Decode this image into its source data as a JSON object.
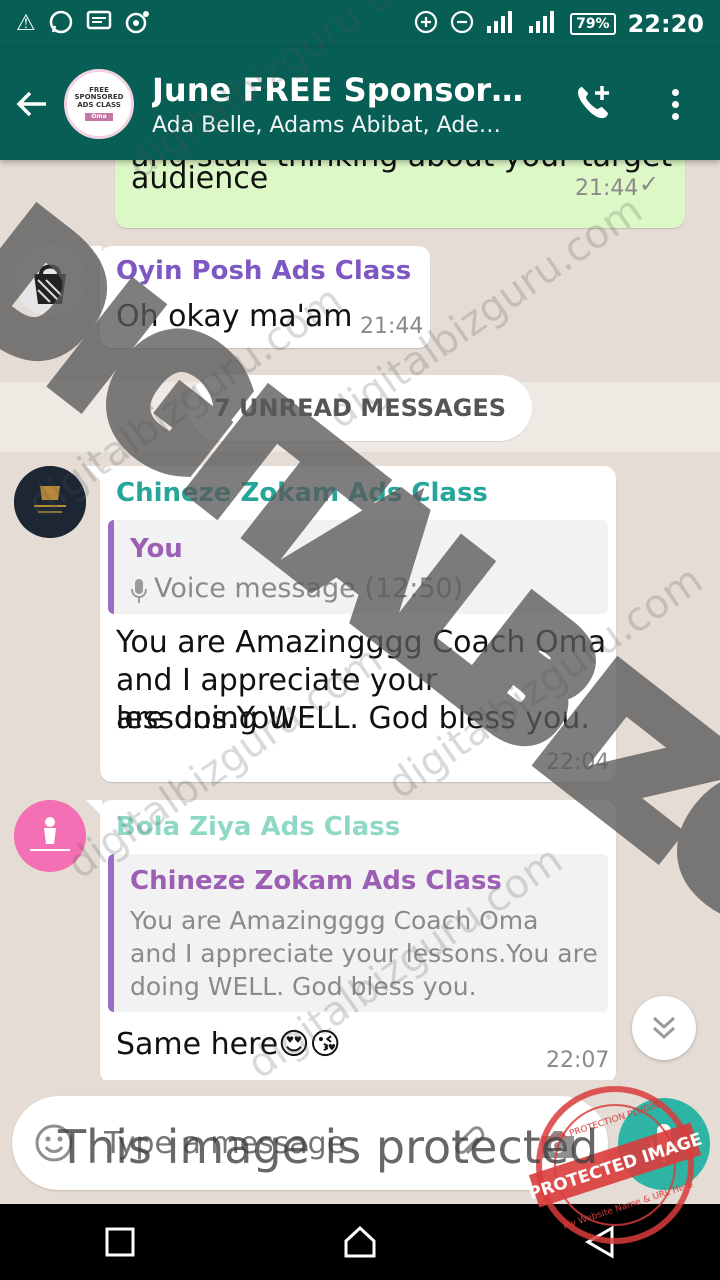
{
  "status_bar": {
    "battery": "79%",
    "time": "22:20"
  },
  "header": {
    "title": "June FREE Sponsore…",
    "members": "Ada Belle, Adams Abibat, Ade…",
    "avatar_lines": [
      "FREE",
      "SPONSORED",
      "ADS CLASS",
      "Oma"
    ]
  },
  "messages": [
    {
      "direction": "out",
      "text_lines": [
        "and start thinking about your target",
        "audience"
      ],
      "time": "21:44",
      "status": "sent"
    },
    {
      "direction": "in",
      "sender": "Oyin Posh Ads Class",
      "sender_color": "#7e57c2",
      "text": "Oh okay ma'am",
      "time": "21:44"
    },
    {
      "direction": "in",
      "sender": "Chineze Zokam Ads Class",
      "sender_color": "#26a69a",
      "quote_author": "You",
      "quote_text": "Voice message (12:50)",
      "text_lines": [
        "You are Amazingggg Coach Oma",
        "and I appreciate your lessons.You",
        "are doing WELL. God bless you."
      ],
      "time": "22:04"
    },
    {
      "direction": "in",
      "sender": "Bola Ziya Ads Class",
      "sender_color": "#8fd8c6",
      "quote_author": "Chineze Zokam Ads Class",
      "quote_lines": [
        "You are Amazingggg Coach Oma",
        "and I appreciate your lessons.You are",
        "doing WELL. God bless you."
      ],
      "text": "Same here",
      "emojis": [
        "😍",
        "😘"
      ],
      "time": "22:07"
    }
  ],
  "unread_label": "7 UNREAD MESSAGES",
  "input": {
    "placeholder": "Type a message"
  },
  "overlay_text": "This image is protected",
  "watermark": {
    "big": "DIGITALBIZGURU",
    "small": "digitalbizguru.com",
    "stamp": "PROTECTED IMAGE",
    "stamp_top": "COPY PROTECTION PLUGIN",
    "stamp_bottom": "My Website Name & URL Here"
  },
  "colors": {
    "header": "#075e54",
    "chat_bg": "#e5ddd5",
    "outgoing": "#dcf8c6",
    "send": "#2eb4a4"
  }
}
